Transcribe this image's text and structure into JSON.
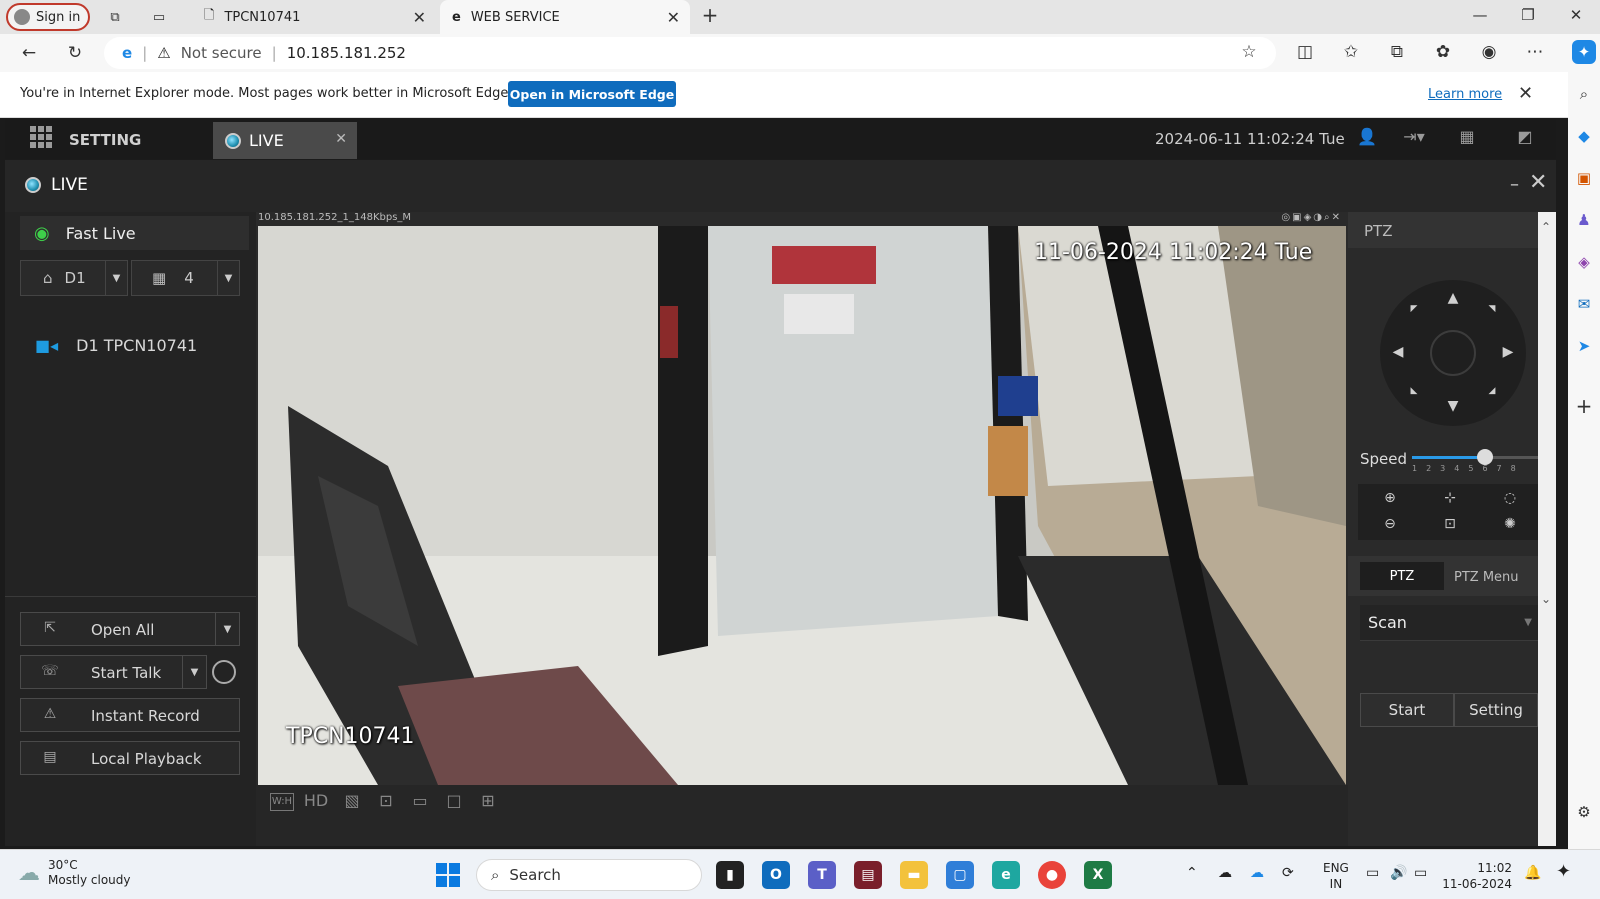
{
  "browser": {
    "signin_label": "Sign in",
    "tabs": [
      {
        "title": "TPCN10741"
      },
      {
        "title": "WEB SERVICE"
      }
    ],
    "address": {
      "security": "Not secure",
      "url": "10.185.181.252"
    },
    "ie_bar": {
      "message": "You're in Internet Explorer mode. Most pages work better in Microsoft Edge.",
      "open_button": "Open in Microsoft Edge",
      "learn_more": "Learn more"
    }
  },
  "app": {
    "menu_label": "SETTING",
    "live_tab": "LIVE",
    "datetime": "2024-06-11 11:02:24 Tue",
    "live_header": "LIVE",
    "left": {
      "fast_live": "Fast Live",
      "channel_select": "D1",
      "layout_select": "4",
      "device": "D1 TPCN10741",
      "buttons": {
        "open_all": "Open All",
        "start_talk": "Start Talk",
        "instant_record": "Instant Record",
        "local_playback": "Local Playback"
      }
    },
    "video": {
      "stream_label": "10.185.181.252_1_148Kbps_M",
      "osd_time": "11-06-2024 11:02:24 Tue",
      "osd_name": "TPCN10741",
      "toolbar": {
        "wh": "W:H",
        "hd": "HD"
      }
    },
    "ptz": {
      "title": "PTZ",
      "speed_label": "Speed",
      "speed_value": 5,
      "speed_ticks": "12345678",
      "tabs": [
        "PTZ",
        "PTZ Menu"
      ],
      "mode": "Scan",
      "start": "Start",
      "setting": "Setting"
    }
  },
  "taskbar": {
    "weather_temp": "30°C",
    "weather_desc": "Mostly cloudy",
    "search": "Search",
    "lang1": "ENG",
    "lang2": "IN",
    "time": "11:02",
    "date": "11-06-2024"
  },
  "colors": {
    "accent": "#0f6cbd",
    "app_bg": "#232323",
    "speed": "#2a9ae8"
  }
}
